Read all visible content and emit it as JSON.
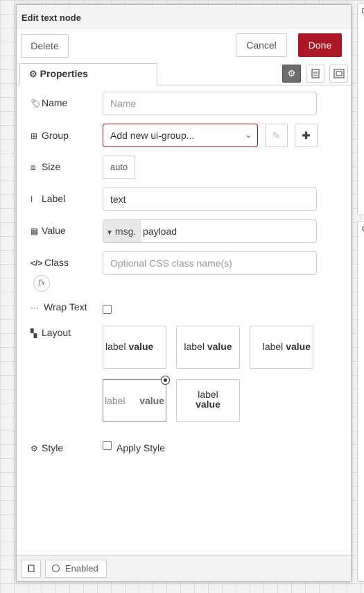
{
  "tray": {
    "title": "Edit text node",
    "delete_label": "Delete",
    "cancel_label": "Cancel",
    "done_label": "Done"
  },
  "tabs": {
    "properties_label": "Properties",
    "properties_icon": "gear-icon",
    "icons": [
      "gear-icon",
      "description-icon",
      "appearance-icon"
    ]
  },
  "form": {
    "name": {
      "label": "Name",
      "icon": "tag-icon",
      "placeholder": "Name",
      "value": ""
    },
    "group": {
      "label": "Group",
      "icon": "table-icon",
      "selected": "Add new ui-group..."
    },
    "size": {
      "label": "Size",
      "icon": "resize-icon",
      "value": "auto"
    },
    "label": {
      "label": "Label",
      "icon": "text-cursor-icon",
      "value": "text"
    },
    "value": {
      "label": "Value",
      "icon": "calculator-icon",
      "type_prefix": "msg.",
      "value": "payload"
    },
    "class": {
      "label": "Class",
      "icon": "code-icon",
      "placeholder": "Optional CSS class name(s)",
      "fx_label": "fx"
    },
    "wrap_text": {
      "label": "Wrap Text",
      "icon": "ellipsis-icon",
      "checked": false
    },
    "layout": {
      "label": "Layout",
      "icon": "grid-icon",
      "selected_index": 3,
      "options": [
        {
          "label": "label",
          "value": "value"
        },
        {
          "label": "label",
          "value": "value"
        },
        {
          "label": "label",
          "value": "value"
        },
        {
          "label": "label",
          "value": "value"
        },
        {
          "label": "label",
          "value": "value"
        }
      ]
    },
    "style": {
      "label": "Style",
      "icon": "gear-icon",
      "checkbox_label": "Apply Style",
      "checked": false
    }
  },
  "footer": {
    "enabled_label": "Enabled",
    "book_icon": "book-icon"
  },
  "colors": {
    "done_bg": "#ad1625",
    "group_border": "#ad1625",
    "active_tab_icon_bg": "#6d6d6d"
  }
}
